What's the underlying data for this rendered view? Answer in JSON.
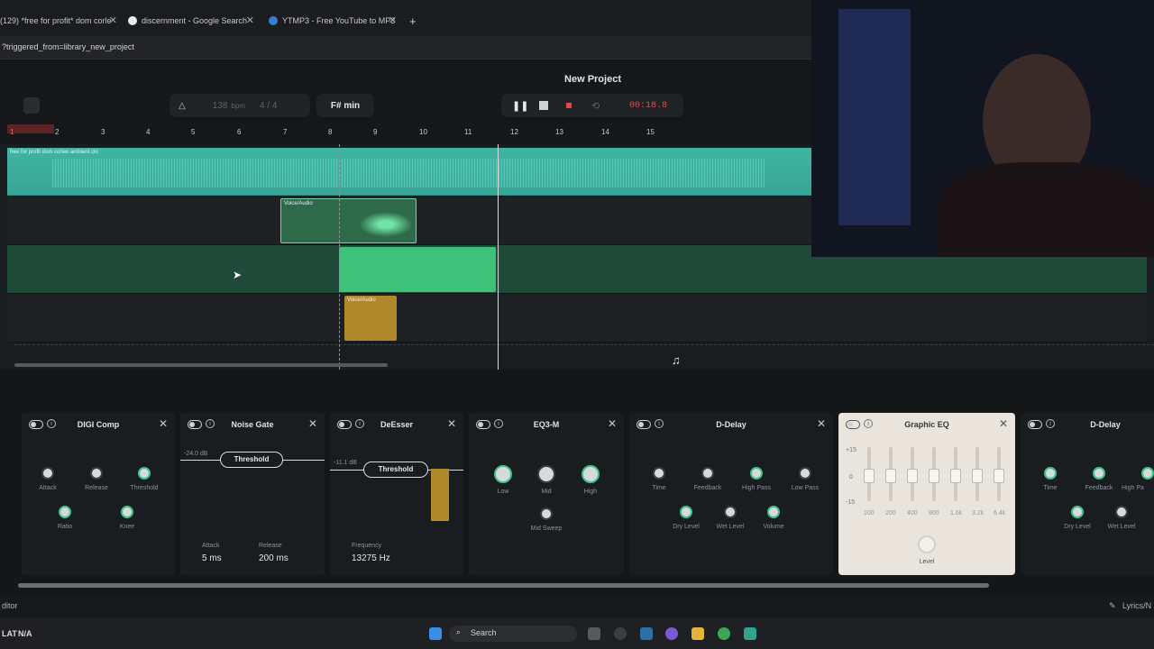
{
  "browser": {
    "tabs": [
      {
        "title": "(129) *free for profit* dom corle"
      },
      {
        "title": "discernment - Google Search"
      },
      {
        "title": "YTMP3 - Free YouTube to MP3"
      }
    ],
    "url": "?triggered_from=library_new_project"
  },
  "daw": {
    "project_title": "New Project",
    "bpm": "138",
    "bpm_unit": "bpm",
    "time_signature": "4 / 4",
    "key": "F# min",
    "time": "00:18.8"
  },
  "timeline": {
    "ruler": [
      "1",
      "2",
      "3",
      "4",
      "5",
      "6",
      "7",
      "8",
      "9",
      "10",
      "11",
      "12",
      "13",
      "14",
      "15"
    ],
    "clips": {
      "main": "free for profit dom corleo  ambient  clo",
      "voice1": "Voice/Audio",
      "voice2": "Voice/Audio"
    }
  },
  "effects": {
    "digi_comp": {
      "title": "DIGI Comp",
      "knobs": [
        "Attack",
        "Release",
        "Threshold",
        "Ratio",
        "Knee"
      ]
    },
    "noise_gate": {
      "title": "Noise Gate",
      "db": "-24.0 dB",
      "threshold": "Threshold",
      "attack_label": "Attack",
      "attack": "5 ms",
      "release_label": "Release",
      "release": "200 ms"
    },
    "deesser": {
      "title": "DeEsser",
      "db": "-11.1 dB",
      "threshold": "Threshold",
      "freq_label": "Frequency",
      "freq": "13275 Hz"
    },
    "eq3": {
      "title": "EQ3-M",
      "knobs": [
        "Low",
        "Mid",
        "High",
        "Mid Sweep"
      ]
    },
    "ddelay": {
      "title": "D-Delay",
      "knobs": [
        "Time",
        "Feedback",
        "High Pass",
        "Low Pass",
        "Dry Level",
        "Wet Level",
        "Volume"
      ]
    },
    "geq": {
      "title": "Graphic EQ",
      "scale": [
        "+15",
        "0",
        "-15"
      ],
      "bands": [
        "100",
        "200",
        "400",
        "800",
        "1.6k",
        "3.2k",
        "6.4k"
      ],
      "level": "Level"
    },
    "ddelay2": {
      "title": "D-Delay",
      "knobs": [
        "Time",
        "Feedback",
        "High Pa",
        "Dry Level",
        "Wet Level"
      ]
    }
  },
  "status": {
    "left": "ditor",
    "right": "Lyrics/N",
    "lat": "LAT",
    "lat_val": "N/A"
  },
  "taskbar": {
    "search": "Search"
  },
  "colors": {
    "accent": "#3ec28a",
    "clip_teal": "#3fb5a3",
    "clip_green": "#3ec27a",
    "clip_gold": "#b08a2a",
    "record": "#e64646"
  }
}
